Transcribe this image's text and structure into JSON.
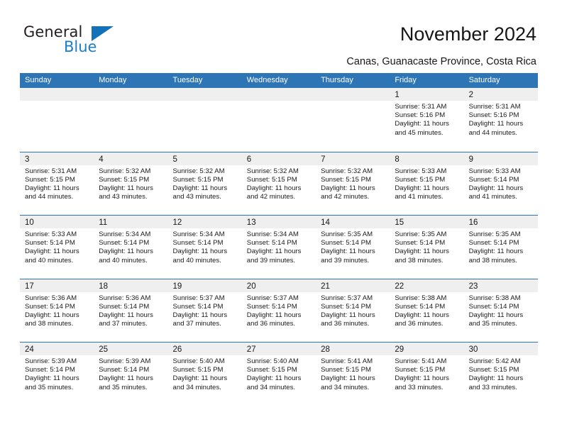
{
  "brand": {
    "name_part1": "General",
    "name_part2": "Blue",
    "logo_icon": "triangle-logo-icon"
  },
  "header": {
    "title": "November 2024",
    "subtitle": "Canas, Guanacaste Province, Costa Rica"
  },
  "colors": {
    "header_blue": "#2e75b6",
    "daynum_band": "#efefef",
    "brand_blue": "#1a7ec8",
    "text": "#161616"
  },
  "calendar": {
    "weekdays": [
      "Sunday",
      "Monday",
      "Tuesday",
      "Wednesday",
      "Thursday",
      "Friday",
      "Saturday"
    ],
    "weeks": [
      [
        {
          "day": "",
          "sunrise": "",
          "sunset": "",
          "daylight1": "",
          "daylight2": ""
        },
        {
          "day": "",
          "sunrise": "",
          "sunset": "",
          "daylight1": "",
          "daylight2": ""
        },
        {
          "day": "",
          "sunrise": "",
          "sunset": "",
          "daylight1": "",
          "daylight2": ""
        },
        {
          "day": "",
          "sunrise": "",
          "sunset": "",
          "daylight1": "",
          "daylight2": ""
        },
        {
          "day": "",
          "sunrise": "",
          "sunset": "",
          "daylight1": "",
          "daylight2": ""
        },
        {
          "day": "1",
          "sunrise": "Sunrise: 5:31 AM",
          "sunset": "Sunset: 5:16 PM",
          "daylight1": "Daylight: 11 hours",
          "daylight2": "and 45 minutes."
        },
        {
          "day": "2",
          "sunrise": "Sunrise: 5:31 AM",
          "sunset": "Sunset: 5:16 PM",
          "daylight1": "Daylight: 11 hours",
          "daylight2": "and 44 minutes."
        }
      ],
      [
        {
          "day": "3",
          "sunrise": "Sunrise: 5:31 AM",
          "sunset": "Sunset: 5:15 PM",
          "daylight1": "Daylight: 11 hours",
          "daylight2": "and 44 minutes."
        },
        {
          "day": "4",
          "sunrise": "Sunrise: 5:32 AM",
          "sunset": "Sunset: 5:15 PM",
          "daylight1": "Daylight: 11 hours",
          "daylight2": "and 43 minutes."
        },
        {
          "day": "5",
          "sunrise": "Sunrise: 5:32 AM",
          "sunset": "Sunset: 5:15 PM",
          "daylight1": "Daylight: 11 hours",
          "daylight2": "and 43 minutes."
        },
        {
          "day": "6",
          "sunrise": "Sunrise: 5:32 AM",
          "sunset": "Sunset: 5:15 PM",
          "daylight1": "Daylight: 11 hours",
          "daylight2": "and 42 minutes."
        },
        {
          "day": "7",
          "sunrise": "Sunrise: 5:32 AM",
          "sunset": "Sunset: 5:15 PM",
          "daylight1": "Daylight: 11 hours",
          "daylight2": "and 42 minutes."
        },
        {
          "day": "8",
          "sunrise": "Sunrise: 5:33 AM",
          "sunset": "Sunset: 5:15 PM",
          "daylight1": "Daylight: 11 hours",
          "daylight2": "and 41 minutes."
        },
        {
          "day": "9",
          "sunrise": "Sunrise: 5:33 AM",
          "sunset": "Sunset: 5:14 PM",
          "daylight1": "Daylight: 11 hours",
          "daylight2": "and 41 minutes."
        }
      ],
      [
        {
          "day": "10",
          "sunrise": "Sunrise: 5:33 AM",
          "sunset": "Sunset: 5:14 PM",
          "daylight1": "Daylight: 11 hours",
          "daylight2": "and 40 minutes."
        },
        {
          "day": "11",
          "sunrise": "Sunrise: 5:34 AM",
          "sunset": "Sunset: 5:14 PM",
          "daylight1": "Daylight: 11 hours",
          "daylight2": "and 40 minutes."
        },
        {
          "day": "12",
          "sunrise": "Sunrise: 5:34 AM",
          "sunset": "Sunset: 5:14 PM",
          "daylight1": "Daylight: 11 hours",
          "daylight2": "and 40 minutes."
        },
        {
          "day": "13",
          "sunrise": "Sunrise: 5:34 AM",
          "sunset": "Sunset: 5:14 PM",
          "daylight1": "Daylight: 11 hours",
          "daylight2": "and 39 minutes."
        },
        {
          "day": "14",
          "sunrise": "Sunrise: 5:35 AM",
          "sunset": "Sunset: 5:14 PM",
          "daylight1": "Daylight: 11 hours",
          "daylight2": "and 39 minutes."
        },
        {
          "day": "15",
          "sunrise": "Sunrise: 5:35 AM",
          "sunset": "Sunset: 5:14 PM",
          "daylight1": "Daylight: 11 hours",
          "daylight2": "and 38 minutes."
        },
        {
          "day": "16",
          "sunrise": "Sunrise: 5:35 AM",
          "sunset": "Sunset: 5:14 PM",
          "daylight1": "Daylight: 11 hours",
          "daylight2": "and 38 minutes."
        }
      ],
      [
        {
          "day": "17",
          "sunrise": "Sunrise: 5:36 AM",
          "sunset": "Sunset: 5:14 PM",
          "daylight1": "Daylight: 11 hours",
          "daylight2": "and 38 minutes."
        },
        {
          "day": "18",
          "sunrise": "Sunrise: 5:36 AM",
          "sunset": "Sunset: 5:14 PM",
          "daylight1": "Daylight: 11 hours",
          "daylight2": "and 37 minutes."
        },
        {
          "day": "19",
          "sunrise": "Sunrise: 5:37 AM",
          "sunset": "Sunset: 5:14 PM",
          "daylight1": "Daylight: 11 hours",
          "daylight2": "and 37 minutes."
        },
        {
          "day": "20",
          "sunrise": "Sunrise: 5:37 AM",
          "sunset": "Sunset: 5:14 PM",
          "daylight1": "Daylight: 11 hours",
          "daylight2": "and 36 minutes."
        },
        {
          "day": "21",
          "sunrise": "Sunrise: 5:37 AM",
          "sunset": "Sunset: 5:14 PM",
          "daylight1": "Daylight: 11 hours",
          "daylight2": "and 36 minutes."
        },
        {
          "day": "22",
          "sunrise": "Sunrise: 5:38 AM",
          "sunset": "Sunset: 5:14 PM",
          "daylight1": "Daylight: 11 hours",
          "daylight2": "and 36 minutes."
        },
        {
          "day": "23",
          "sunrise": "Sunrise: 5:38 AM",
          "sunset": "Sunset: 5:14 PM",
          "daylight1": "Daylight: 11 hours",
          "daylight2": "and 35 minutes."
        }
      ],
      [
        {
          "day": "24",
          "sunrise": "Sunrise: 5:39 AM",
          "sunset": "Sunset: 5:14 PM",
          "daylight1": "Daylight: 11 hours",
          "daylight2": "and 35 minutes."
        },
        {
          "day": "25",
          "sunrise": "Sunrise: 5:39 AM",
          "sunset": "Sunset: 5:14 PM",
          "daylight1": "Daylight: 11 hours",
          "daylight2": "and 35 minutes."
        },
        {
          "day": "26",
          "sunrise": "Sunrise: 5:40 AM",
          "sunset": "Sunset: 5:15 PM",
          "daylight1": "Daylight: 11 hours",
          "daylight2": "and 34 minutes."
        },
        {
          "day": "27",
          "sunrise": "Sunrise: 5:40 AM",
          "sunset": "Sunset: 5:15 PM",
          "daylight1": "Daylight: 11 hours",
          "daylight2": "and 34 minutes."
        },
        {
          "day": "28",
          "sunrise": "Sunrise: 5:41 AM",
          "sunset": "Sunset: 5:15 PM",
          "daylight1": "Daylight: 11 hours",
          "daylight2": "and 34 minutes."
        },
        {
          "day": "29",
          "sunrise": "Sunrise: 5:41 AM",
          "sunset": "Sunset: 5:15 PM",
          "daylight1": "Daylight: 11 hours",
          "daylight2": "and 33 minutes."
        },
        {
          "day": "30",
          "sunrise": "Sunrise: 5:42 AM",
          "sunset": "Sunset: 5:15 PM",
          "daylight1": "Daylight: 11 hours",
          "daylight2": "and 33 minutes."
        }
      ]
    ]
  }
}
